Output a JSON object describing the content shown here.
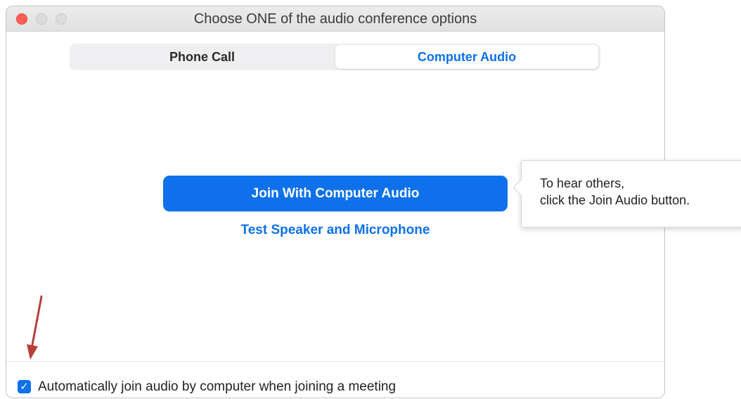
{
  "window": {
    "title": "Choose ONE of the audio conference options"
  },
  "tabs": [
    {
      "label": "Phone Call",
      "selected": false
    },
    {
      "label": "Computer Audio",
      "selected": true
    }
  ],
  "main": {
    "join_button": "Join With Computer Audio",
    "test_link": "Test Speaker and Microphone"
  },
  "footer": {
    "auto_join_checked": true,
    "auto_join_label": "Automatically join audio by computer when joining a meeting"
  },
  "tooltip": {
    "line1": "To hear others,",
    "line2": "click the Join Audio button."
  },
  "colors": {
    "accent": "#0e71eb",
    "annotation_arrow": "#b5403a"
  },
  "icons": {
    "checkbox": "checkmark-icon",
    "annotation": "red-arrow-icon"
  }
}
